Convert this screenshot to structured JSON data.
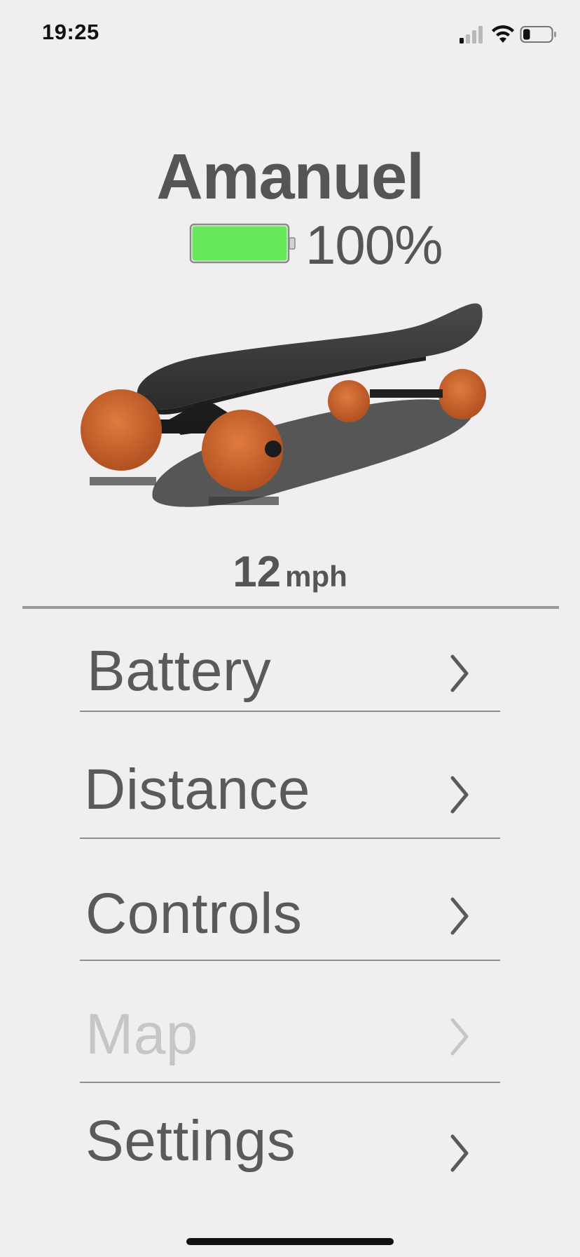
{
  "status_bar": {
    "time": "19:25",
    "signal_icon": "cellular-signal-icon",
    "wifi_icon": "wifi-icon",
    "battery_icon": "status-battery-icon",
    "phone_battery_level": 0.25
  },
  "board": {
    "name": "Amanuel",
    "battery_percent": "100%",
    "battery_level": 1.0,
    "battery_color": "#66e85a",
    "image": "electric-skateboard"
  },
  "speed": {
    "value": "12",
    "unit": "mph"
  },
  "menu": {
    "items": [
      {
        "label": "Battery",
        "enabled": true,
        "icon": "chevron-right-icon"
      },
      {
        "label": "Distance",
        "enabled": true,
        "icon": "chevron-right-icon"
      },
      {
        "label": "Controls",
        "enabled": true,
        "icon": "chevron-right-icon"
      },
      {
        "label": "Map",
        "enabled": false,
        "icon": "chevron-right-icon"
      },
      {
        "label": "Settings",
        "enabled": true,
        "icon": "chevron-right-icon"
      }
    ]
  },
  "colors": {
    "background": "#f0eeef",
    "text": "#5a5a5a",
    "disabled_text": "#c7c5c6",
    "wheel": "#c8602a"
  }
}
